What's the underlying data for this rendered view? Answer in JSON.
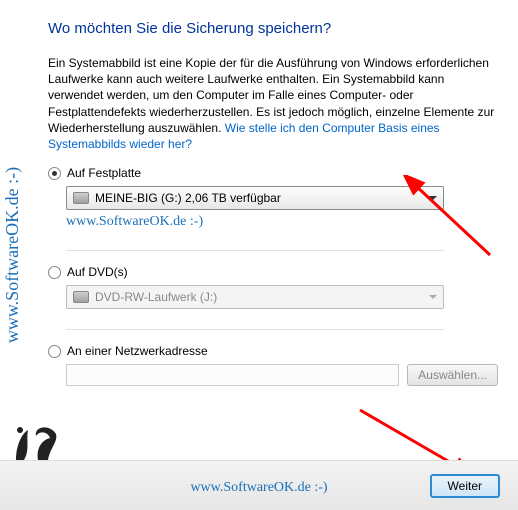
{
  "watermark": "www.SoftwareOK.de :-)",
  "title": "Wo möchten Sie die Sicherung speichern?",
  "description_pre": "Ein Systemabbild ist eine Kopie der für die Ausführung von Windows erforderlichen Laufwerke kann auch weitere Laufwerke enthalten. Ein Systemabbild kann verwendet werden, um den Computer im Falle eines Computer- oder Festplattendefekts wiederherzustellen. Es ist jedoch möglich, einzelne Elemente zur Wiederherstellung auszuwählen.",
  "description_link": "Wie stelle ich den Computer Basis eines Systemabbilds wieder her?",
  "options": {
    "hdd": {
      "label": "Auf Festplatte",
      "value": "MEINE-BIG (G:)  2,06 TB verfügbar"
    },
    "dvd": {
      "label": "Auf DVD(s)",
      "value": "DVD-RW-Laufwerk (J:)"
    },
    "net": {
      "label": "An einer Netzwerkadresse",
      "button": "Auswählen..."
    }
  },
  "url_text": "www.SoftwareOK.de :-)",
  "footer": {
    "next": "Weiter"
  }
}
